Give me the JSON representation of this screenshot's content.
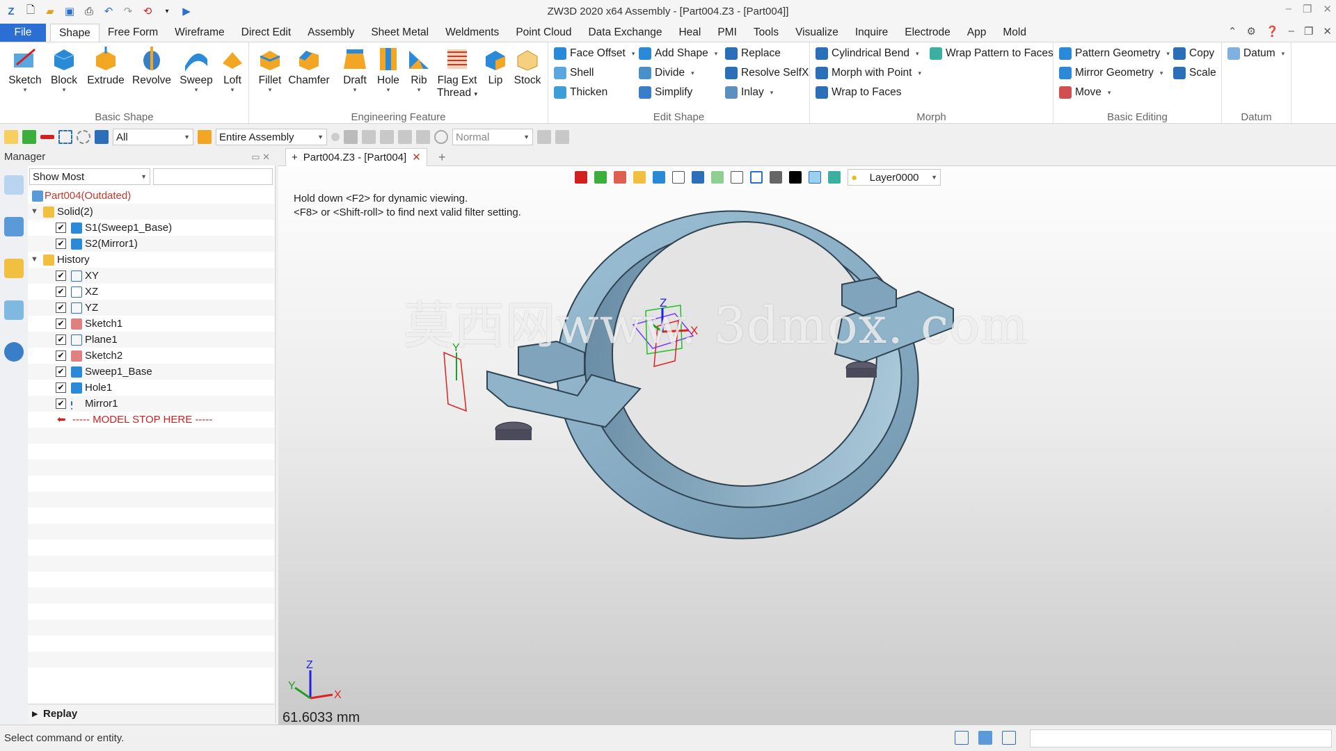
{
  "titlebar": {
    "title": "ZW3D 2020 x64        Assembly - [Part004.Z3 - [Part004]]"
  },
  "menu": [
    "File",
    "Shape",
    "Free Form",
    "Wireframe",
    "Direct Edit",
    "Assembly",
    "Sheet Metal",
    "Weldments",
    "Point Cloud",
    "Data Exchange",
    "Heal",
    "PMI",
    "Tools",
    "Visualize",
    "Inquire",
    "Electrode",
    "App",
    "Mold"
  ],
  "ribbon": {
    "basic_shape": {
      "label": "Basic Shape",
      "buttons": [
        "Sketch",
        "Block",
        "Extrude",
        "Revolve",
        "Sweep",
        "Loft"
      ]
    },
    "engineering": {
      "label": "Engineering Feature",
      "buttons": [
        "Fillet",
        "Chamfer",
        "Draft",
        "Hole",
        "Rib",
        "Flag Ext",
        "Thread",
        "Lip",
        "Stock"
      ]
    },
    "edit_shape": {
      "label": "Edit Shape",
      "buttons": [
        "Face Offset",
        "Shell",
        "Thicken",
        "Add Shape",
        "Divide",
        "Simplify",
        "Replace",
        "Resolve SelfX",
        "Inlay"
      ]
    },
    "morph": {
      "label": "Morph",
      "buttons": [
        "Cylindrical Bend",
        "Morph with Point",
        "Wrap to Faces",
        "Wrap Pattern to Faces"
      ]
    },
    "basic_editing": {
      "label": "Basic Editing",
      "buttons": [
        "Pattern Geometry",
        "Mirror Geometry",
        "Move",
        "Copy",
        "Scale"
      ]
    },
    "datum": {
      "label": "Datum",
      "buttons": [
        "Datum"
      ]
    }
  },
  "toolbar": {
    "filter": "All",
    "scope": "Entire Assembly",
    "mode": "Normal"
  },
  "manager": {
    "title": "Manager",
    "view_mode": "Show Most",
    "tree": [
      {
        "label": "Part004(Outdated)"
      },
      {
        "label": "Solid(2)"
      },
      {
        "label": "S1(Sweep1_Base)"
      },
      {
        "label": "S2(Mirror1)"
      },
      {
        "label": "History"
      },
      {
        "label": "XY"
      },
      {
        "label": "XZ"
      },
      {
        "label": "YZ"
      },
      {
        "label": "Sketch1"
      },
      {
        "label": "Plane1"
      },
      {
        "label": "Sketch2"
      },
      {
        "label": "Sweep1_Base"
      },
      {
        "label": "Hole1"
      },
      {
        "label": "Mirror1"
      },
      {
        "label": "----- MODEL STOP HERE -----"
      }
    ],
    "replay": "Replay"
  },
  "doc_tab": {
    "label": "Part004.Z3 - [Part004]"
  },
  "viewport": {
    "layer": "Layer0000",
    "hint1": "Hold down <F2> for dynamic viewing.",
    "hint2": "<F8> or <Shift-roll> to find next valid filter setting.",
    "dimension": "61.6033 mm",
    "watermark": "莫西网www. 3dmox. com",
    "axes": {
      "x": "X",
      "y": "Y",
      "z": "Z"
    }
  },
  "status": {
    "text": "Select command or entity."
  },
  "colors": {
    "accent": "#2b6fd4",
    "part_fill": "#8fb3c9",
    "outdated": "#c0392b"
  }
}
